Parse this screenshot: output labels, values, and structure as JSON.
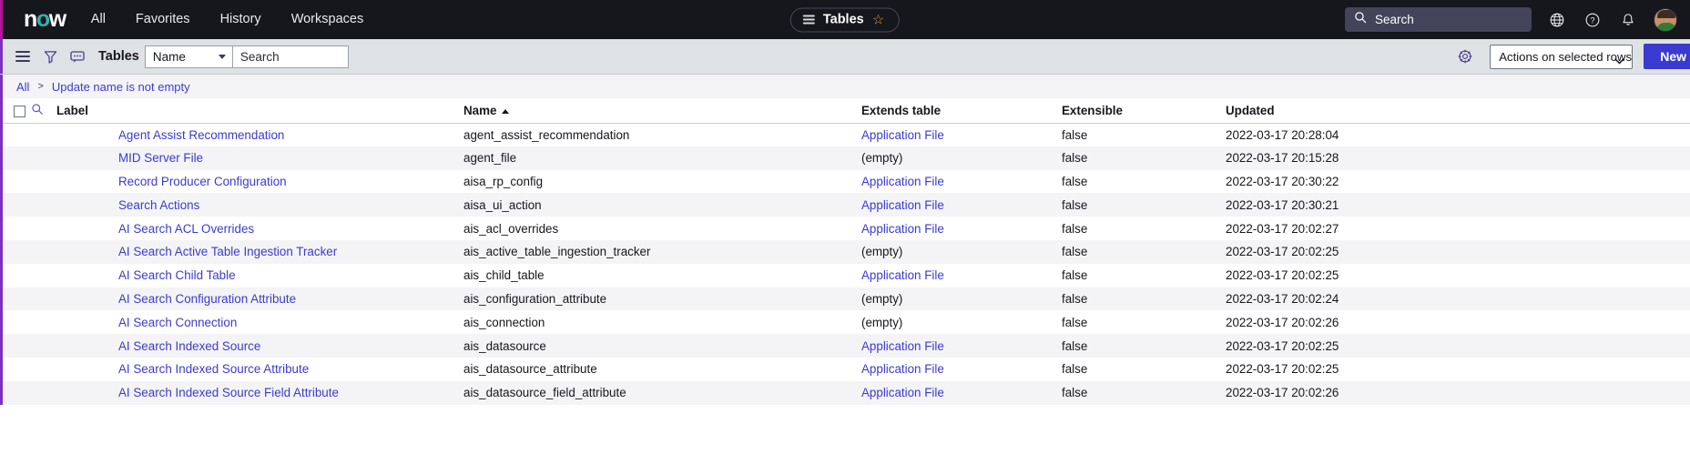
{
  "topbar": {
    "logo_text": "now",
    "logo_o": "o",
    "nav": [
      {
        "label": "All"
      },
      {
        "label": "Favorites"
      },
      {
        "label": "History"
      },
      {
        "label": "Workspaces"
      }
    ],
    "pill": {
      "label": "Tables",
      "menu_icon": "list-icon",
      "star_icon": "star-icon",
      "star_glyph": "☆"
    },
    "search": {
      "placeholder": "Search",
      "icon": "search-icon"
    },
    "icons": [
      {
        "name": "globe-icon"
      },
      {
        "name": "help-icon"
      },
      {
        "name": "notifications-bell-icon"
      }
    ],
    "avatar": {
      "name": "user-avatar"
    },
    "colors": {
      "background": "#16161d",
      "accent_edge": "#b5139b",
      "search_bg": "#43435a",
      "logo_accent": "#2fb3ad"
    }
  },
  "toolbar": {
    "menu_icon": "hamburger-icon",
    "filter_icon": "funnel-filter-icon",
    "comment_icon": "comment-icon",
    "title": "Tables",
    "field_select": {
      "value": "Name"
    },
    "search": {
      "value": "Search"
    },
    "gear_icon": "gear-icon",
    "actions_select": {
      "value": "Actions on selected rows..."
    },
    "new_button": {
      "label": "New"
    },
    "colors": {
      "background": "#dfe2e5",
      "accent_edge": "#7d2fbf",
      "primary_button": "#3a3ad1"
    }
  },
  "breadcrumb": {
    "items": [
      {
        "label": "All"
      },
      {
        "label": "Update name is not empty"
      }
    ],
    "separator": ">"
  },
  "table": {
    "columns": [
      {
        "key": "label",
        "label": "Label",
        "sorted": false
      },
      {
        "key": "name",
        "label": "Name",
        "sorted": true,
        "direction": "asc"
      },
      {
        "key": "extends",
        "label": "Extends table",
        "sorted": false
      },
      {
        "key": "extensible",
        "label": "Extensible",
        "sorted": false
      },
      {
        "key": "updated",
        "label": "Updated",
        "sorted": false
      }
    ],
    "select_all_checkbox": "select-all-rows",
    "search_row_icon": "column-search-icon",
    "empty_value": "(empty)",
    "rows": [
      {
        "label": "Agent Assist Recommendation",
        "name": "agent_assist_recommendation",
        "extends": "Application File",
        "extends_link": true,
        "extensible": "false",
        "updated": "2022-03-17 20:28:04"
      },
      {
        "label": "MID Server File",
        "name": "agent_file",
        "extends": "(empty)",
        "extends_link": false,
        "extensible": "false",
        "updated": "2022-03-17 20:15:28"
      },
      {
        "label": "Record Producer Configuration",
        "name": "aisa_rp_config",
        "extends": "Application File",
        "extends_link": true,
        "extensible": "false",
        "updated": "2022-03-17 20:30:22"
      },
      {
        "label": "Search Actions",
        "name": "aisa_ui_action",
        "extends": "Application File",
        "extends_link": true,
        "extensible": "false",
        "updated": "2022-03-17 20:30:21"
      },
      {
        "label": "AI Search ACL Overrides",
        "name": "ais_acl_overrides",
        "extends": "Application File",
        "extends_link": true,
        "extensible": "false",
        "updated": "2022-03-17 20:02:27"
      },
      {
        "label": "AI Search Active Table Ingestion Tracker",
        "name": "ais_active_table_ingestion_tracker",
        "extends": "(empty)",
        "extends_link": false,
        "extensible": "false",
        "updated": "2022-03-17 20:02:25"
      },
      {
        "label": "AI Search Child Table",
        "name": "ais_child_table",
        "extends": "Application File",
        "extends_link": true,
        "extensible": "false",
        "updated": "2022-03-17 20:02:25"
      },
      {
        "label": "AI Search Configuration Attribute",
        "name": "ais_configuration_attribute",
        "extends": "(empty)",
        "extends_link": false,
        "extensible": "false",
        "updated": "2022-03-17 20:02:24"
      },
      {
        "label": "AI Search Connection",
        "name": "ais_connection",
        "extends": "(empty)",
        "extends_link": false,
        "extensible": "false",
        "updated": "2022-03-17 20:02:26"
      },
      {
        "label": "AI Search Indexed Source",
        "name": "ais_datasource",
        "extends": "Application File",
        "extends_link": true,
        "extensible": "false",
        "updated": "2022-03-17 20:02:25"
      },
      {
        "label": "AI Search Indexed Source Attribute",
        "name": "ais_datasource_attribute",
        "extends": "Application File",
        "extends_link": true,
        "extensible": "false",
        "updated": "2022-03-17 20:02:25"
      },
      {
        "label": "AI Search Indexed Source Field Attribute",
        "name": "ais_datasource_field_attribute",
        "extends": "Application File",
        "extends_link": true,
        "extensible": "false",
        "updated": "2022-03-17 20:02:26"
      }
    ]
  }
}
